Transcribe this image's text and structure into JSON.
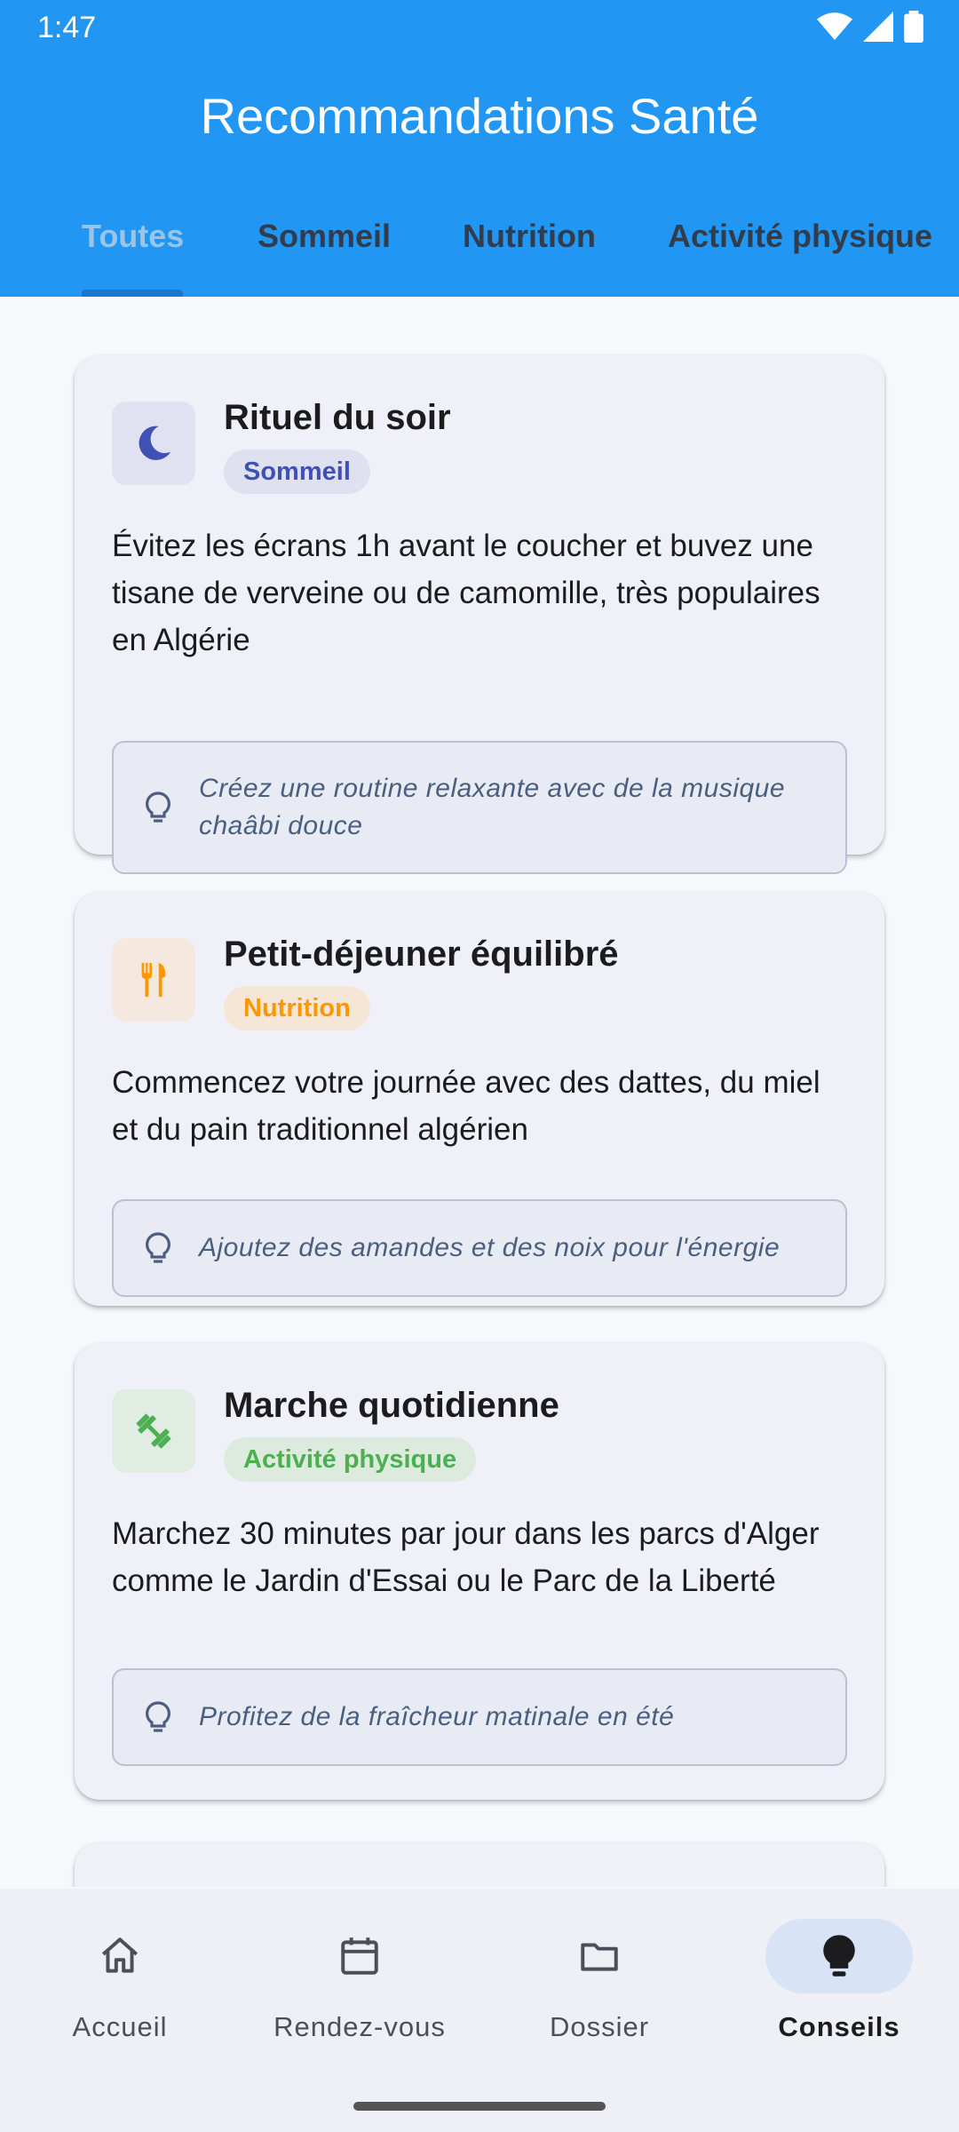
{
  "status": {
    "time": "1:47"
  },
  "header": {
    "title": "Recommandations Santé"
  },
  "tabs": [
    {
      "label": "Toutes",
      "active": true
    },
    {
      "label": "Sommeil",
      "active": false
    },
    {
      "label": "Nutrition",
      "active": false
    },
    {
      "label": "Activité physique",
      "active": false
    }
  ],
  "cards": [
    {
      "icon": "moon-icon",
      "title": "Rituel du soir",
      "category": "Sommeil",
      "category_color": "#3f51b5",
      "description": "Évitez les écrans 1h avant le coucher et buvez une tisane de verveine ou de camomille, très populaires en Algérie",
      "tip": "Créez une routine relaxante avec de la musique chaâbi douce"
    },
    {
      "icon": "restaurant-icon",
      "title": "Petit-déjeuner équilibré",
      "category": "Nutrition",
      "category_color": "#ff9800",
      "description": "Commencez votre journée avec des dattes, du miel et du pain traditionnel algérien",
      "tip": "Ajoutez des amandes et des noix pour l'énergie"
    },
    {
      "icon": "fitness-icon",
      "title": "Marche quotidienne",
      "category": "Activité physique",
      "category_color": "#4caf50",
      "description": "Marchez 30 minutes par jour dans les parcs d'Alger comme le Jardin d'Essai ou le Parc de la Liberté",
      "tip": "Profitez de la fraîcheur matinale en été"
    }
  ],
  "nav": [
    {
      "label": "Accueil",
      "icon": "home-icon",
      "active": false
    },
    {
      "label": "Rendez-vous",
      "icon": "calendar-icon",
      "active": false
    },
    {
      "label": "Dossier",
      "icon": "folder-icon",
      "active": false
    },
    {
      "label": "Conseils",
      "icon": "lightbulb-icon",
      "active": true
    }
  ],
  "colors": {
    "primary": "#2196f3",
    "tab_indicator": "#1976d2"
  }
}
